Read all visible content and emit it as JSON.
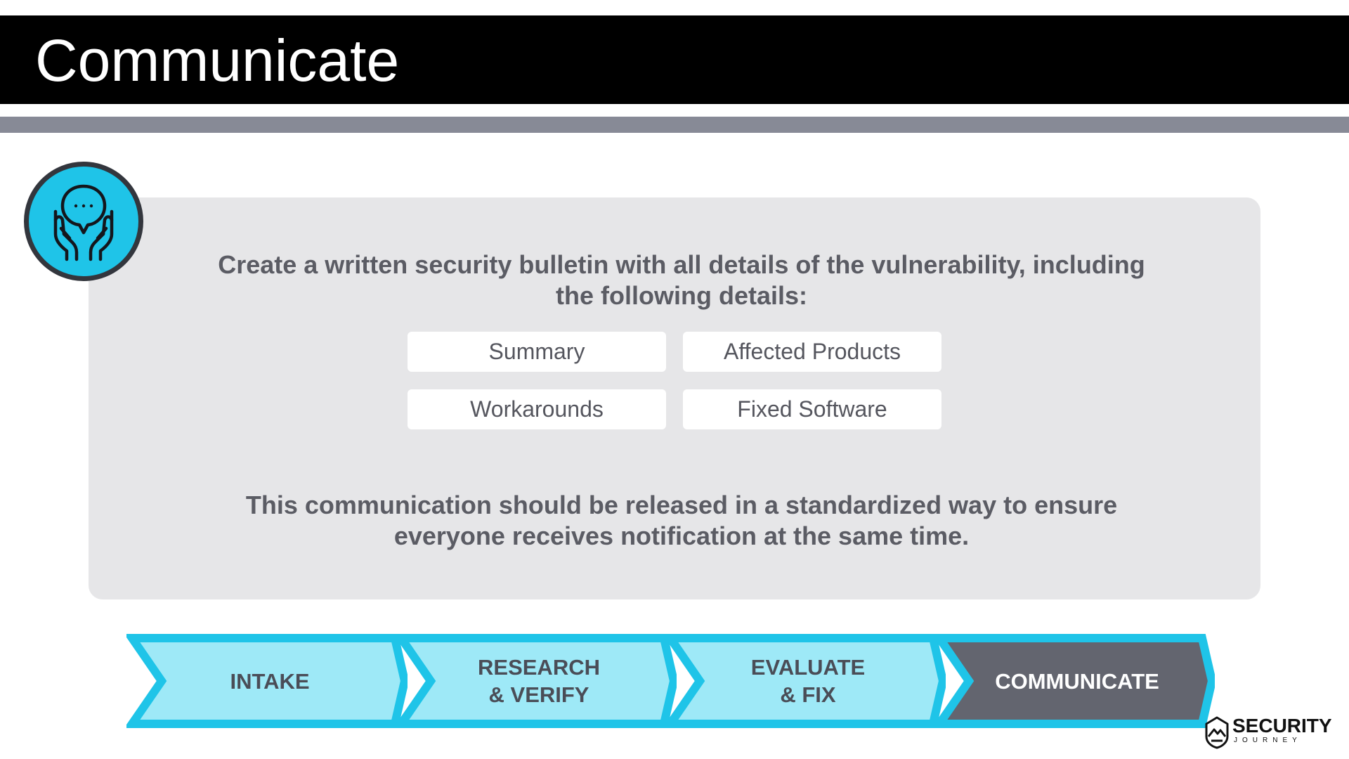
{
  "slide": {
    "title": "Communicate",
    "intro": "Create a written security bulletin with all details of the vulnerability, including the following details:",
    "details": [
      "Summary",
      "Affected Products",
      "Workarounds",
      "Fixed Software"
    ],
    "footer": "This communication should be released in a standardized way to ensure everyone receives notification at the same time."
  },
  "process": {
    "steps": [
      {
        "label": "INTAKE",
        "active": false
      },
      {
        "label": "RESEARCH\n& VERIFY",
        "active": false
      },
      {
        "label": "EVALUATE\n& FIX",
        "active": false
      },
      {
        "label": "COMMUNICATE",
        "active": true
      }
    ]
  },
  "icon": {
    "name": "hands-speech-bubble-icon"
  },
  "logo": {
    "word": "SECURITY",
    "sub": "JOURNEY",
    "icon": "mountain-lock-icon"
  },
  "colors": {
    "title_bar": "#000000",
    "accent_bar": "#878a96",
    "panel": "#e6e6e8",
    "cyan": "#1fc4e8",
    "cyan_light": "#9ee9f7",
    "active_step": "#63656f",
    "text": "#5b5c64"
  }
}
